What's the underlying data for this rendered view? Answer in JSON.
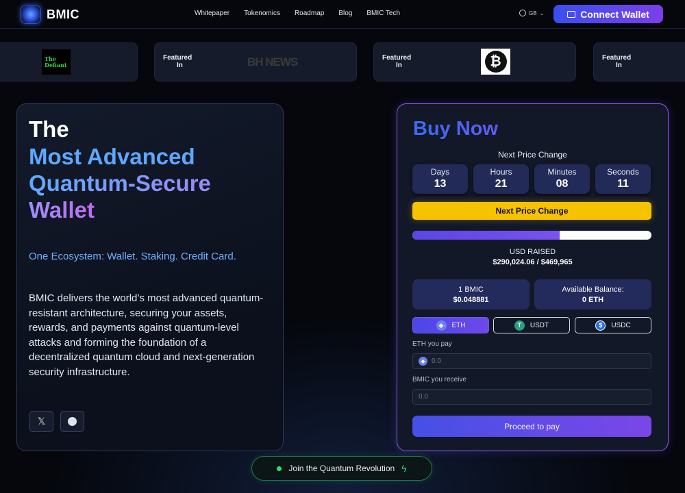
{
  "brand": {
    "name": "BMIC"
  },
  "nav": {
    "links": [
      "Whitepaper",
      "Tokenomics",
      "Roadmap",
      "Blog",
      "BMIC Tech"
    ],
    "lang": "GB",
    "connect_label": "Connect Wallet"
  },
  "featured": {
    "label_line1": "Featured",
    "label_line2": "In",
    "logos": {
      "defiant_line1": "The",
      "defiant_line2": "Defiant",
      "bhnews": "BH NEWS",
      "btc": "₿"
    }
  },
  "hero": {
    "line1": "The",
    "line2": "Most Advanced",
    "line3": "Quantum-Secure",
    "line4": "Wallet",
    "tagline": "One Ecosystem: Wallet. Staking. Credit Card.",
    "description": "BMIC delivers the world’s most advanced quantum-resistant architecture, securing your assets, rewards, and payments against quantum-level attacks and forming the foundation of a decentralized quantum cloud and next-generation security infrastructure.",
    "social": {
      "x": "𝕏"
    }
  },
  "buy": {
    "title": "Buy Now",
    "next_price_label": "Next Price Change",
    "countdown": [
      {
        "label": "Days",
        "value": "13"
      },
      {
        "label": "Hours",
        "value": "21"
      },
      {
        "label": "Minutes",
        "value": "08"
      },
      {
        "label": "Seconds",
        "value": "11"
      }
    ],
    "next_price_button": "Next Price Change",
    "progress_fraction": 0.617,
    "raised_label": "USD RAISED",
    "raised_value": "$290,024.06 / $469,965",
    "price_label": "1 BMIC",
    "price_value": "$0.048881",
    "balance_label": "Available Balance:",
    "balance_value": "0 ETH",
    "tokens": [
      {
        "label": "ETH",
        "icon": "eth-icon",
        "selected": true
      },
      {
        "label": "USDT",
        "icon": "usdt-icon",
        "selected": false
      },
      {
        "label": "USDC",
        "icon": "usdc-icon",
        "selected": false
      }
    ],
    "pay_label": "ETH you pay",
    "pay_value": "0.0",
    "receive_label": "BMIC you receive",
    "receive_value": "0.0",
    "proceed_label": "Proceed to pay"
  },
  "join": {
    "label": "Join the Quantum Revolution"
  },
  "colors": {
    "accent": "#3b4ef0",
    "purple": "#7b3fe8",
    "yellow": "#f7c200",
    "green": "#2fe06a"
  }
}
